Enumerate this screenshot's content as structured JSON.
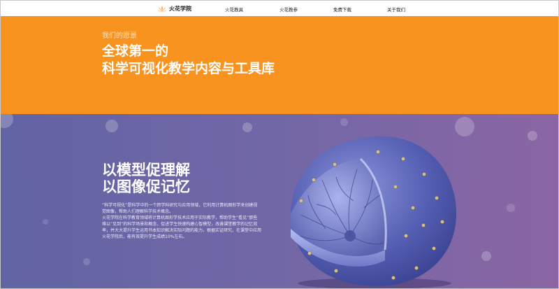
{
  "nav": {
    "brand": "火花学院",
    "items": [
      {
        "label": "火花教具"
      },
      {
        "label": "火花教参"
      },
      {
        "label": "免费下载"
      },
      {
        "label": "关于我们"
      }
    ]
  },
  "hero": {
    "subtitle": "我们的愿景",
    "title_line1": "全球第一的",
    "title_line2": "科学可视化教学内容与工具库"
  },
  "section": {
    "title_line1": "以模型促理解",
    "title_line2": "以图像促记忆",
    "paragraph1": "“科学可视化”是科学中的一个跨学科研究与应用领域，它利用计算机图形学来创建视觉图像，帮助人们理解科学技术概念。",
    "paragraph2": "火花学院在科学教育领域将计算机图形学技术应用于实际教学，帮助学生“看见”那些难以“见到”的科学场景和概念，促进学生快速构建心智模型，改善课堂教学的记忆效率，并大大提升学生运用书本知识解决实际问题的能力。根据实证研究，在课堂中应用火花学院后，能有效提升学生成绩10%左右。"
  },
  "colors": {
    "hero_bg": "#f7931e",
    "section_gradient_start": "#6264a4",
    "section_gradient_end": "#8b66a4",
    "logo": "#f7931e"
  },
  "icons": [
    "flame-logo-icon"
  ]
}
